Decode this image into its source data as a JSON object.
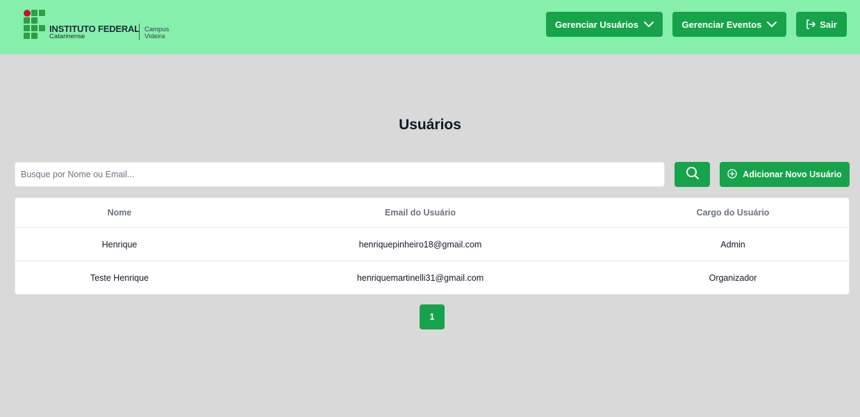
{
  "header": {
    "logo": {
      "line1": "INSTITUTO FEDERAL",
      "line2": "Catarinense",
      "campus_line1": "Campus",
      "campus_line2": "Videira"
    },
    "nav": {
      "manage_users_label": "Gerenciar Usuários",
      "manage_events_label": "Gerenciar Eventos",
      "logout_label": "Sair"
    }
  },
  "main": {
    "title": "Usuários",
    "search": {
      "placeholder": "Busque por Nome ou Email...",
      "value": ""
    },
    "add_button_label": "Adicionar Novo Usuário",
    "table": {
      "columns": [
        "Nome",
        "Email do Usuário",
        "Cargo do Usuário"
      ],
      "rows": [
        [
          "Henrique",
          "henriquepinheiro18@gmail.com",
          "Admin"
        ],
        [
          "Teste Henrique",
          "henriquemartinelli31@gmail.com",
          "Organizador"
        ]
      ]
    },
    "pagination": {
      "current_page": "1"
    }
  },
  "icons": {
    "search": "search-icon",
    "chevron": "chevron-down-icon",
    "logout": "logout-icon",
    "add": "plus-circle-icon"
  },
  "colors": {
    "header_bg": "#86efac",
    "primary": "#16a34a",
    "page_bg": "#d9d9d9",
    "logo_red": "#c8102e",
    "logo_green": "#2f9e44"
  }
}
